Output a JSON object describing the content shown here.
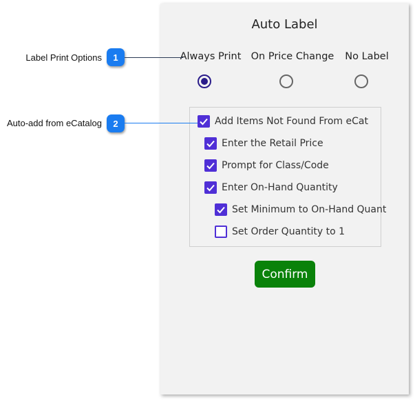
{
  "dialog": {
    "title": "Auto Label",
    "print_options": [
      {
        "label": "Always Print",
        "selected": true
      },
      {
        "label": "On Price Change",
        "selected": false
      },
      {
        "label": "No Label",
        "selected": false
      }
    ],
    "checkboxes": [
      {
        "label": "Add Items Not Found From eCat",
        "checked": true,
        "level": 0
      },
      {
        "label": "Enter the Retail Price",
        "checked": true,
        "level": 1
      },
      {
        "label": "Prompt for Class/Code",
        "checked": true,
        "level": 1
      },
      {
        "label": "Enter On-Hand Quantity",
        "checked": true,
        "level": 1
      },
      {
        "label": "Set Minimum to On-Hand Quant",
        "checked": true,
        "level": 2
      },
      {
        "label": "Set Order Quantity to 1",
        "checked": false,
        "level": 2
      }
    ],
    "confirm_label": "Confirm"
  },
  "callouts": [
    {
      "number": "1",
      "label": "Label Print Options"
    },
    {
      "number": "2",
      "label": "Auto-add from eCatalog"
    }
  ],
  "colors": {
    "accent": "#4f2fd6",
    "radio": "#2a1c8a",
    "confirm": "#0a820a",
    "badge": "#1a7cf0"
  }
}
